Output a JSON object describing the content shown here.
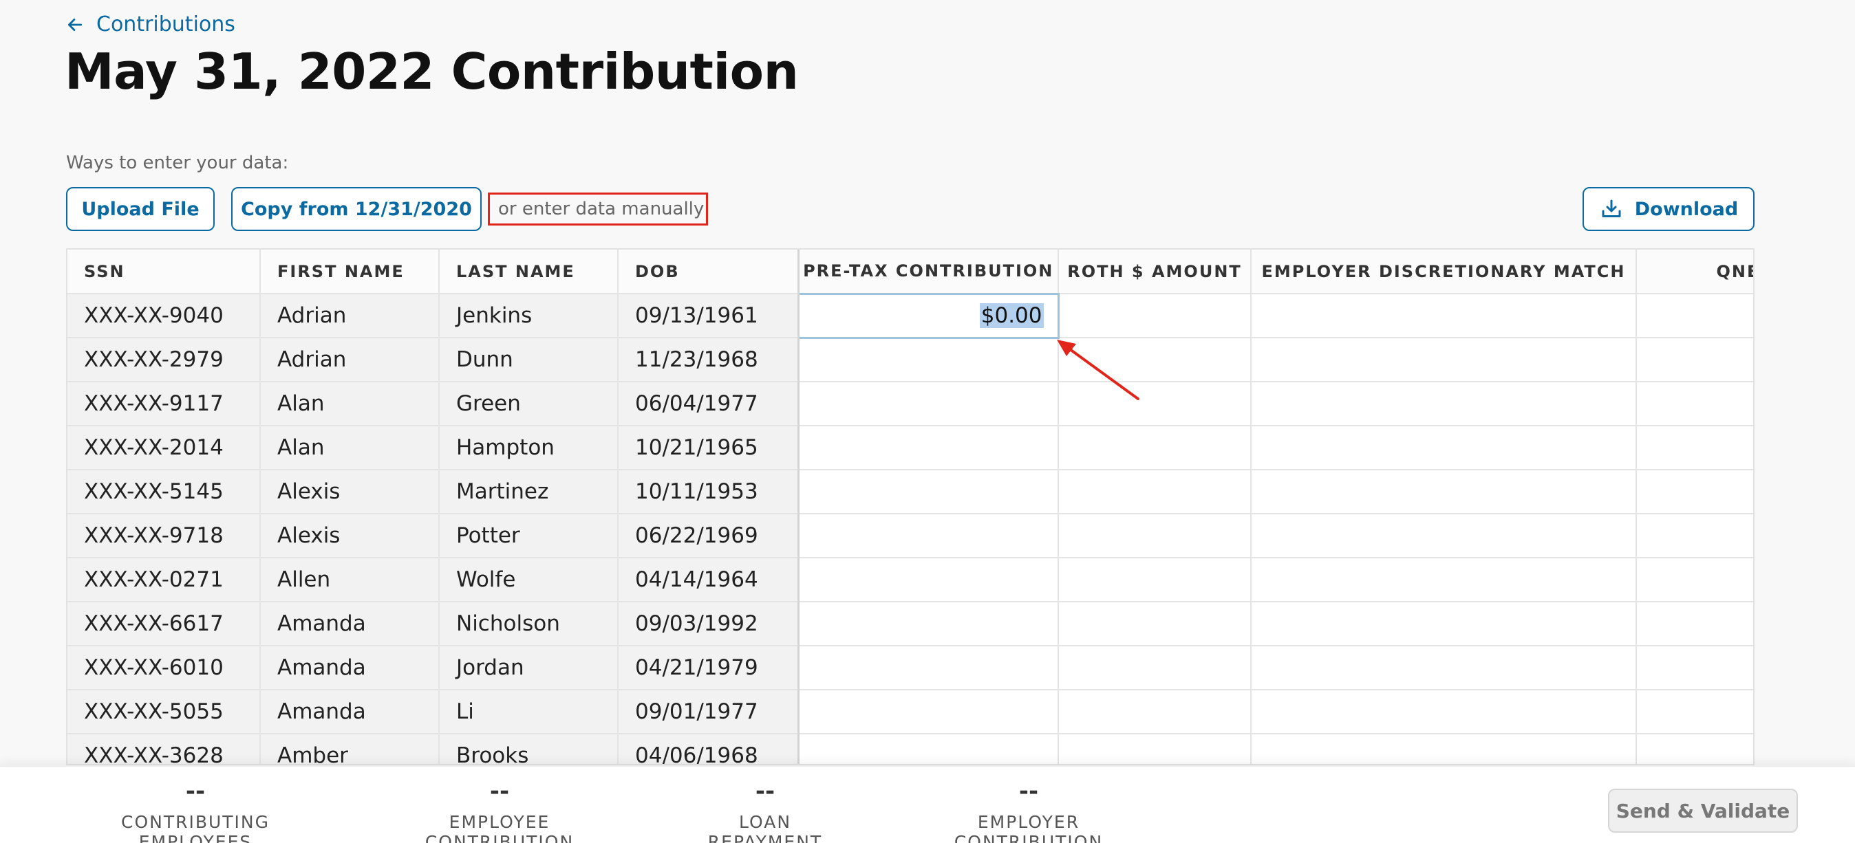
{
  "nav": {
    "back_label": "Contributions"
  },
  "page": {
    "title": "May 31, 2022 Contribution"
  },
  "entry": {
    "ways_label": "Ways to enter your data:",
    "upload_label": "Upload File",
    "copy_label": "Copy from 12/31/2020",
    "manual_hint": "or enter data manually",
    "download_label": "Download"
  },
  "table": {
    "headers": {
      "ssn": "SSN",
      "first": "FIRST NAME",
      "last": "LAST NAME",
      "dob": "DOB",
      "pretax": "PRE-TAX CONTRIBUTION",
      "roth": "ROTH $ AMOUNT",
      "edm": "EMPLOYER DISCRETIONARY MATCH",
      "qnec": "QNEC"
    },
    "active_cell_value": "$0.00",
    "rows": [
      {
        "ssn": "XXX-XX-9040",
        "first": "Adrian",
        "last": "Jenkins",
        "dob": "09/13/1961"
      },
      {
        "ssn": "XXX-XX-2979",
        "first": "Adrian",
        "last": "Dunn",
        "dob": "11/23/1968"
      },
      {
        "ssn": "XXX-XX-9117",
        "first": "Alan",
        "last": "Green",
        "dob": "06/04/1977"
      },
      {
        "ssn": "XXX-XX-2014",
        "first": "Alan",
        "last": "Hampton",
        "dob": "10/21/1965"
      },
      {
        "ssn": "XXX-XX-5145",
        "first": "Alexis",
        "last": "Martinez",
        "dob": "10/11/1953"
      },
      {
        "ssn": "XXX-XX-9718",
        "first": "Alexis",
        "last": "Potter",
        "dob": "06/22/1969"
      },
      {
        "ssn": "XXX-XX-0271",
        "first": "Allen",
        "last": "Wolfe",
        "dob": "04/14/1964"
      },
      {
        "ssn": "XXX-XX-6617",
        "first": "Amanda",
        "last": "Nicholson",
        "dob": "09/03/1992"
      },
      {
        "ssn": "XXX-XX-6010",
        "first": "Amanda",
        "last": "Jordan",
        "dob": "04/21/1979"
      },
      {
        "ssn": "XXX-XX-5055",
        "first": "Amanda",
        "last": "Li",
        "dob": "09/01/1977"
      },
      {
        "ssn": "XXX-XX-3628",
        "first": "Amber",
        "last": "Brooks",
        "dob": "04/06/1968"
      }
    ]
  },
  "footer": {
    "stats": [
      {
        "value": "--",
        "label": "CONTRIBUTING EMPLOYEES"
      },
      {
        "value": "--",
        "label": "EMPLOYEE CONTRIBUTION"
      },
      {
        "value": "--",
        "label": "LOAN REPAYMENT"
      },
      {
        "value": "--",
        "label": "EMPLOYER CONTRIBUTION"
      }
    ],
    "send_label": "Send & Validate"
  },
  "colors": {
    "accent": "#0a6aa1",
    "annotation": "#e2251b",
    "selection": "#b3d1ee"
  }
}
